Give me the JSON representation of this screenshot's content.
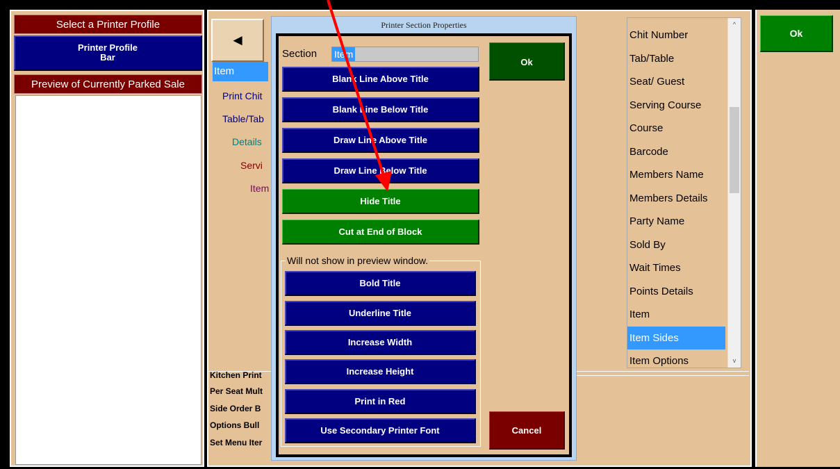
{
  "left": {
    "select_profile": "Select a Printer Profile",
    "profile_line1": "Printer Profile",
    "profile_line2": "Bar",
    "preview_header": "Preview of Currently Parked Sale"
  },
  "middle": {
    "back_label": "◄",
    "tree": [
      "Item",
      "Print Chit",
      "Table/Tab",
      "Details",
      "Servi",
      "Item"
    ],
    "bottom_items": [
      "Kitchen Print",
      "Per Seat Mult",
      "Side Order B",
      "Options Bull",
      "Set Menu Iter"
    ]
  },
  "right_list": {
    "items": [
      "Chit Number",
      "Tab/Table",
      "Seat/ Guest",
      "Serving Course",
      "Course",
      "Barcode",
      "Members Name",
      "Members Details",
      "Party Name",
      "Sold By",
      "Wait Times",
      "Points Details",
      "Item",
      "Item Sides",
      "Item Options"
    ],
    "selected_index": 13
  },
  "ok_main": "Ok",
  "dialog": {
    "title": "Printer Section Properties",
    "section_label": "Section",
    "section_value": "Item",
    "ok": "Ok",
    "cancel": "Cancel",
    "buttons": [
      "Blank Line Above Title",
      "Blank Line Below Title",
      "Draw Line Above Title",
      "Draw Line Below Title",
      "Hide Title",
      "Cut at End of Block"
    ],
    "group_label": "Will not show in preview window.",
    "group_buttons": [
      "Bold Title",
      "Underline Title",
      "Increase Width",
      "Increase Height",
      "Print in Red",
      "Use Secondary Printer Font"
    ]
  },
  "colors": {
    "navy": "#000080",
    "green": "#008000",
    "maroon": "#7a0000",
    "tan": "#e5c197",
    "highlight": "#3399ff",
    "annotation": "#ff0000"
  }
}
